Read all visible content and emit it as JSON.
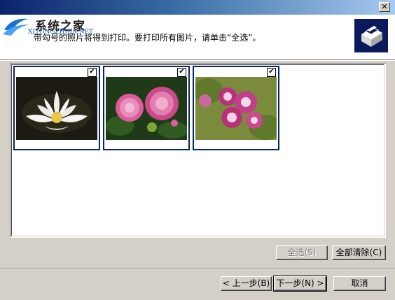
{
  "window": {
    "close_glyph": "✕"
  },
  "logo": {
    "title": "系统之家",
    "subtitle": "XITONGZHIJIA.NET"
  },
  "header": {
    "instruction": "带勾号的照片将得到打印。要打印所有图片，请单击“全选”。",
    "icon": "printer-icon"
  },
  "thumbnails": [
    {
      "name": "white-lotus",
      "checked": true
    },
    {
      "name": "pink-peonies",
      "checked": true
    },
    {
      "name": "pink-geranium",
      "checked": true
    }
  ],
  "buttons": {
    "select_all": "全选(S)",
    "clear_all": "全部清除(C)",
    "back": "< 上一步(B)",
    "next": "下一步(N) >",
    "cancel": "取消"
  },
  "check_glyph": "✔"
}
